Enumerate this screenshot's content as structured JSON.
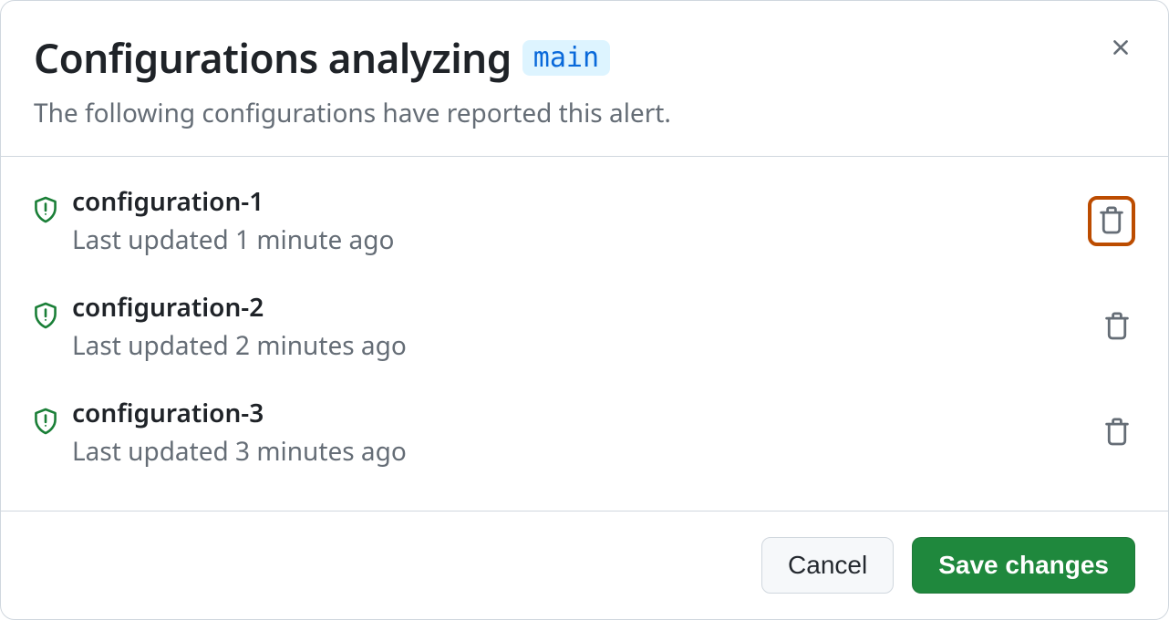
{
  "header": {
    "title": "Configurations analyzing",
    "branch": "main",
    "subtitle": "The following configurations have reported this alert."
  },
  "configurations": [
    {
      "name": "configuration-1",
      "updated": "Last updated 1 minute ago",
      "highlighted": true
    },
    {
      "name": "configuration-2",
      "updated": "Last updated 2 minutes ago",
      "highlighted": false
    },
    {
      "name": "configuration-3",
      "updated": "Last updated 3 minutes ago",
      "highlighted": false
    }
  ],
  "footer": {
    "cancel": "Cancel",
    "save": "Save changes"
  }
}
